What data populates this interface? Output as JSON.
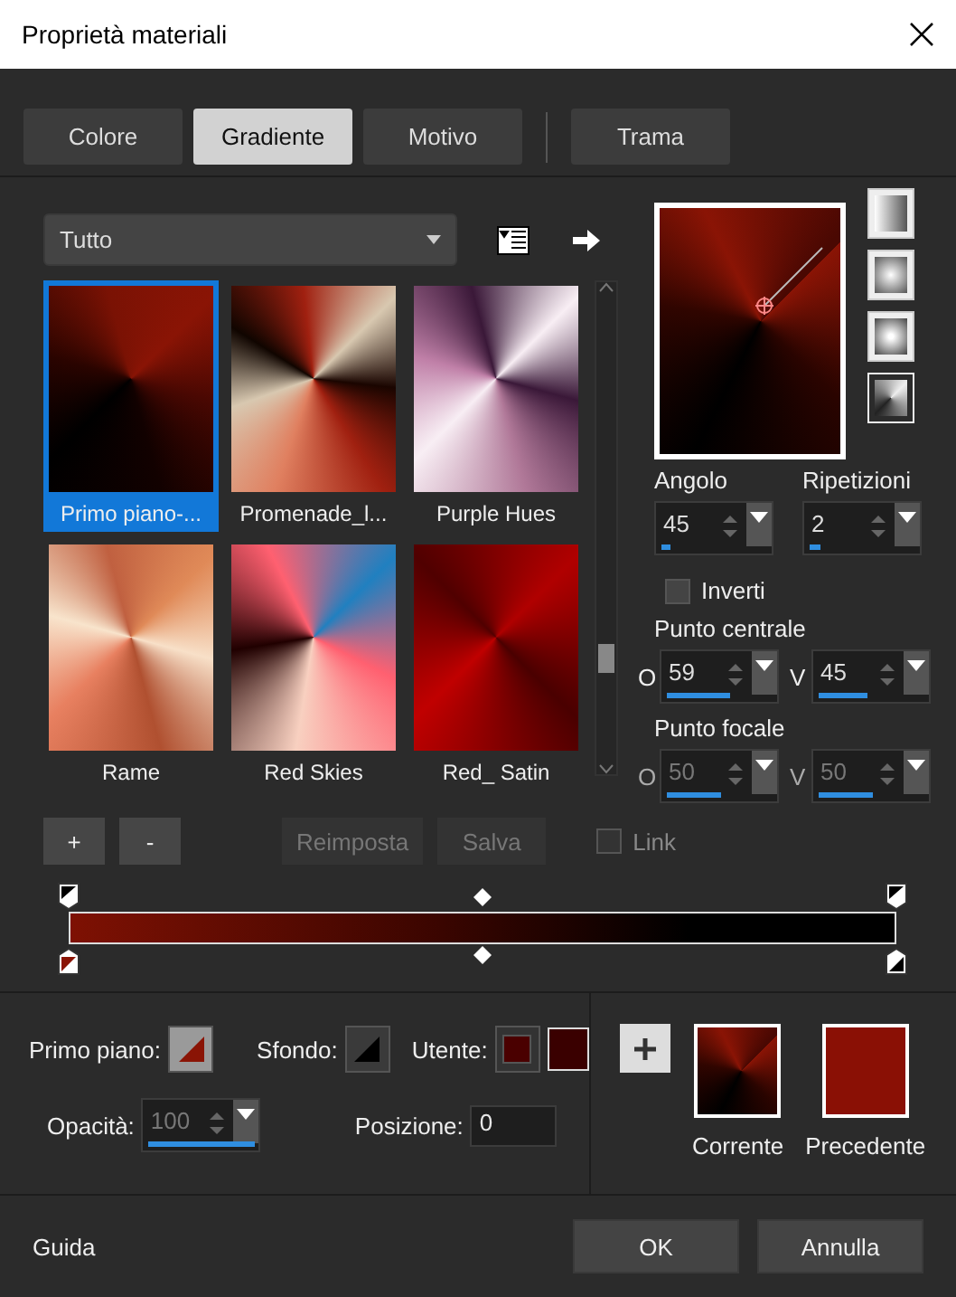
{
  "window": {
    "title": "Proprietà materiali"
  },
  "tabs": [
    {
      "label": "Colore",
      "selected": false
    },
    {
      "label": "Gradiente",
      "selected": true
    },
    {
      "label": "Motivo",
      "selected": false
    },
    {
      "label": "Trama",
      "selected": false
    }
  ],
  "library": {
    "category": "Tutto",
    "items": [
      {
        "name": "Primo piano-...",
        "selected": true
      },
      {
        "name": "Promenade_l...",
        "selected": false
      },
      {
        "name": "Purple Hues",
        "selected": false
      },
      {
        "name": "Rame",
        "selected": false
      },
      {
        "name": "Red Skies",
        "selected": false
      },
      {
        "name": "Red_ Satin",
        "selected": false
      }
    ]
  },
  "styles": [
    {
      "selected": false
    },
    {
      "selected": false
    },
    {
      "selected": false
    },
    {
      "selected": true
    }
  ],
  "angle": {
    "label": "Angolo",
    "value": "45",
    "level": 0.08
  },
  "repeats": {
    "label": "Ripetizioni",
    "value": "2",
    "level": 0.1
  },
  "invert": {
    "label": "Inverti",
    "checked": false
  },
  "center": {
    "label": "Punto centrale",
    "h": {
      "axis": "O",
      "value": "59",
      "level": 0.59
    },
    "v": {
      "axis": "V",
      "value": "45",
      "level": 0.45
    }
  },
  "focal": {
    "label": "Punto focale",
    "disabled": true,
    "h": {
      "axis": "O",
      "value": "50",
      "level": 0.5
    },
    "v": {
      "axis": "V",
      "value": "50",
      "level": 0.5
    }
  },
  "actions": [
    {
      "label": "+",
      "disabled": false
    },
    {
      "label": "-",
      "disabled": false
    },
    {
      "label": "Reimposta",
      "disabled": true
    },
    {
      "label": "Salva",
      "disabled": true
    }
  ],
  "link": {
    "label": "Link",
    "checked": false,
    "disabled": true
  },
  "swatches": {
    "foreground": "Primo piano:",
    "background": "Sfondo:",
    "user": "Utente:"
  },
  "opacity": {
    "label": "Opacità:",
    "value": "100",
    "level": 1,
    "disabled": true
  },
  "position": {
    "label": "Posizione:",
    "value": "0"
  },
  "compare": {
    "current": "Corrente",
    "previous": "Precedente"
  },
  "footer": {
    "help": "Guida",
    "ok": "OK",
    "cancel": "Annulla"
  }
}
